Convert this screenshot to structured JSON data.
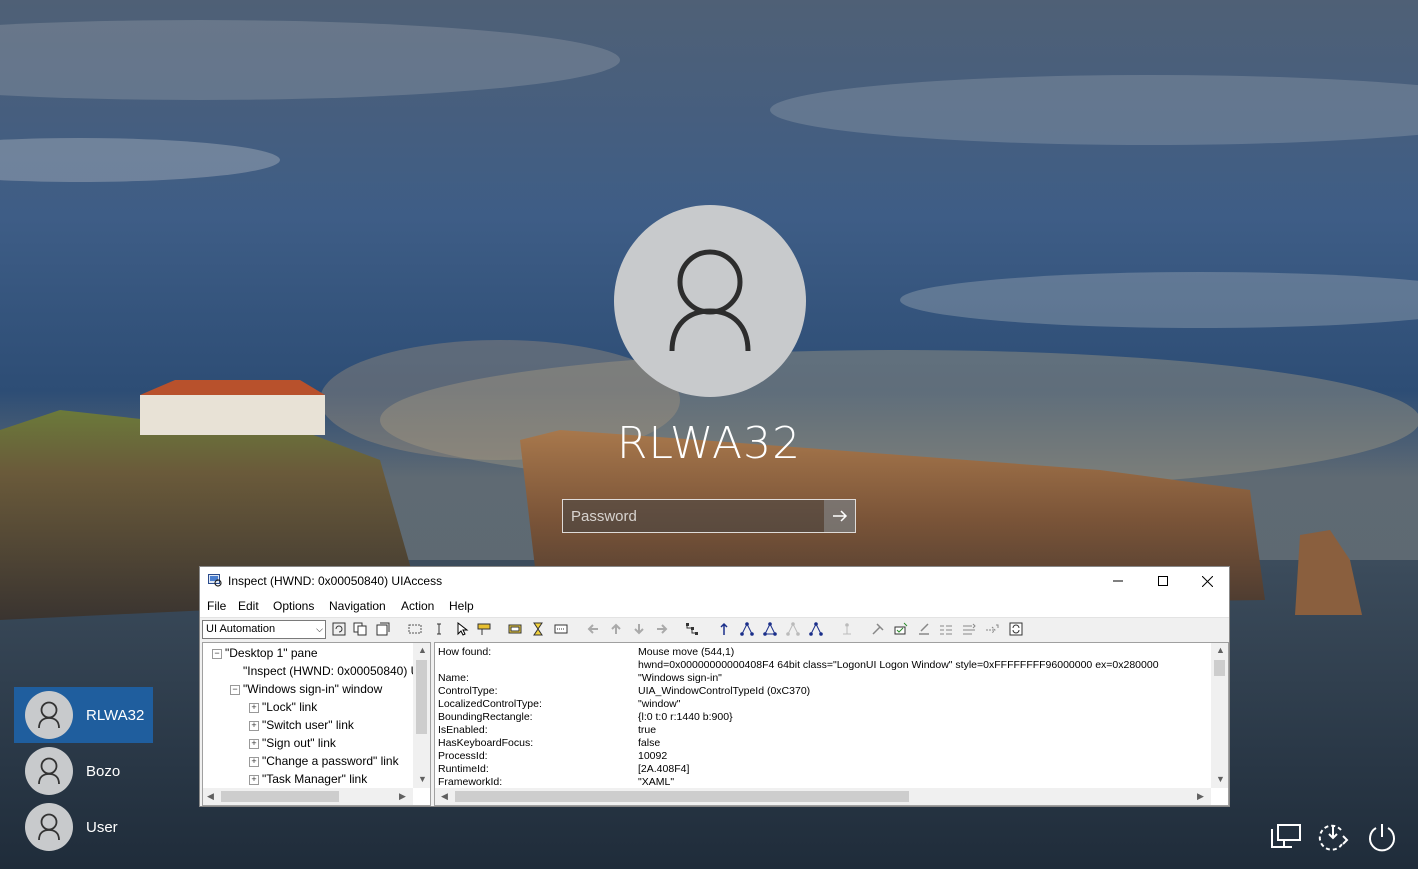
{
  "lock_screen": {
    "username": "RLWA32",
    "password_placeholder": "Password",
    "users": [
      {
        "name": "RLWA32",
        "selected": true
      },
      {
        "name": "Bozo",
        "selected": false
      },
      {
        "name": "User",
        "selected": false
      }
    ],
    "corner_icons": [
      "network-icon",
      "ease-of-access-icon",
      "power-icon"
    ]
  },
  "inspect": {
    "title": "Inspect  (HWND: 0x00050840) UIAccess",
    "menu": [
      "File",
      "Edit",
      "Options",
      "Navigation",
      "Action",
      "Help"
    ],
    "mode_select": "UI Automation",
    "tree": [
      {
        "label": "\"Desktop 1\" pane",
        "expander": "-"
      },
      {
        "label": "\"Inspect  (HWND: 0x00050840) U",
        "expander": ""
      },
      {
        "label": "\"Windows sign-in\" window",
        "expander": "-"
      },
      {
        "label": "\"Lock\" link",
        "expander": "+"
      },
      {
        "label": "\"Switch user\" link",
        "expander": "+"
      },
      {
        "label": "\"Sign out\" link",
        "expander": "+"
      },
      {
        "label": "\"Change a password\" link",
        "expander": "+"
      },
      {
        "label": "\"Task Manager\" link",
        "expander": "+"
      }
    ],
    "properties": [
      {
        "name": "How found:",
        "value": "Mouse move (544,1)"
      },
      {
        "name": "",
        "value": "hwnd=0x00000000000408F4 64bit class=\"LogonUI Logon Window\" style=0xFFFFFFFF96000000 ex=0x280000"
      },
      {
        "name": "Name:",
        "value": "\"Windows sign-in\""
      },
      {
        "name": "ControlType:",
        "value": "UIA_WindowControlTypeId (0xC370)"
      },
      {
        "name": "LocalizedControlType:",
        "value": "\"window\""
      },
      {
        "name": "BoundingRectangle:",
        "value": "{l:0 t:0 r:1440 b:900}"
      },
      {
        "name": "IsEnabled:",
        "value": "true"
      },
      {
        "name": "HasKeyboardFocus:",
        "value": "false"
      },
      {
        "name": "ProcessId:",
        "value": "10092"
      },
      {
        "name": "RuntimeId:",
        "value": "[2A.408F4]"
      },
      {
        "name": "FrameworkId:",
        "value": "\"XAML\""
      }
    ]
  }
}
